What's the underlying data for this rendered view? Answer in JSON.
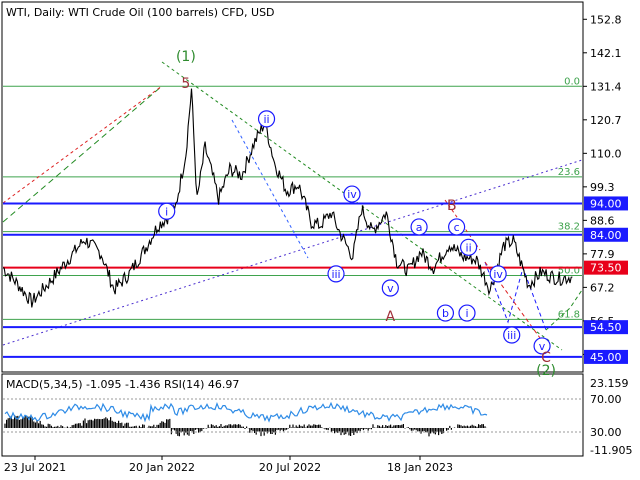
{
  "chart_data": [
    {
      "type": "line",
      "title": "WTI, Daily:  WTI Crude Oil (100 barrels) CFD, USD",
      "price_axis": {
        "ticks": [
          152.8,
          142.1,
          131.4,
          120.7,
          110.0,
          99.3,
          88.6,
          77.9,
          67.2,
          56.5,
          45.8
        ],
        "ylim": [
          40.5,
          158.0
        ]
      },
      "x_axis": {
        "ticks": [
          "23 Jul 2021",
          "20 Jan 2022",
          "20 Jul 2022",
          "18 Jan 2023"
        ],
        "xlim": [
          "2021-07-15",
          "2023-07-10"
        ]
      },
      "series": [
        {
          "color": "#000000",
          "x": [
            "2021-07-15",
            "2021-08-05",
            "2021-08-20",
            "2021-09-10",
            "2021-10-01",
            "2021-10-25",
            "2021-11-15",
            "2021-12-01",
            "2021-12-20",
            "2022-01-10",
            "2022-01-25",
            "2022-02-15",
            "2022-03-01",
            "2022-03-08",
            "2022-03-15",
            "2022-03-25",
            "2022-04-11",
            "2022-04-25",
            "2022-05-10",
            "2022-05-25",
            "2022-06-08",
            "2022-06-20",
            "2022-07-05",
            "2022-07-20",
            "2022-08-05",
            "2022-08-16",
            "2022-08-30",
            "2022-09-10",
            "2022-09-26",
            "2022-10-07",
            "2022-10-20",
            "2022-11-07",
            "2022-11-20",
            "2022-12-05",
            "2022-12-20",
            "2023-01-05",
            "2023-01-25",
            "2023-02-10",
            "2023-02-28",
            "2023-03-17",
            "2023-04-03",
            "2023-04-15",
            "2023-05-04",
            "2023-05-20",
            "2023-06-10",
            "2023-06-28"
          ],
          "y": [
            73.5,
            67.5,
            62.5,
            68.5,
            75.0,
            82.5,
            78.0,
            66.5,
            71.5,
            80.0,
            87.0,
            91.5,
            110.0,
            130.5,
            95.0,
            112.0,
            95.5,
            105.0,
            103.0,
            113.0,
            120.0,
            107.0,
            98.0,
            100.0,
            88.0,
            87.0,
            91.0,
            84.5,
            77.0,
            92.5,
            85.0,
            91.0,
            75.5,
            72.5,
            78.5,
            73.5,
            81.0,
            77.0,
            76.0,
            66.5,
            80.5,
            82.0,
            68.0,
            72.0,
            70.0,
            70.5
          ]
        }
      ],
      "levels": [
        {
          "value": 94.0,
          "label": "94.00",
          "color": "#1a1aff"
        },
        {
          "value": 84.0,
          "label": "84.00",
          "color": "#1a1aff"
        },
        {
          "value": 73.5,
          "label": "73.50",
          "color": "#e8001a"
        },
        {
          "value": 54.5,
          "label": "54.50",
          "color": "#1a1aff"
        },
        {
          "value": 45.0,
          "label": "45.00",
          "color": "#1a1aff"
        }
      ],
      "fibo_levels": [
        {
          "value": 131.4,
          "label": "0.0"
        },
        {
          "value": 102.5,
          "label": "23.6"
        },
        {
          "value": 85.0,
          "label": "38.2"
        },
        {
          "value": 71.0,
          "label": "50.0"
        },
        {
          "value": 57.0,
          "label": "61.8"
        }
      ],
      "annotations": [
        {
          "text": "(1)",
          "x": "2022-03-01",
          "y": 141.0,
          "color": "#2e8b2e"
        },
        {
          "text": "5",
          "x": "2022-03-01",
          "y": 132.5,
          "color": "#a0303a"
        },
        {
          "text": "ii",
          "x": "2022-06-10",
          "y": 121.0,
          "color": "#1a1aff",
          "circled": true
        },
        {
          "text": "i",
          "x": "2022-02-05",
          "y": 91.5,
          "color": "#1a1aff",
          "circled": true
        },
        {
          "text": "iv",
          "x": "2022-09-25",
          "y": 97.0,
          "color": "#1a1aff",
          "circled": true
        },
        {
          "text": "iii",
          "x": "2022-09-05",
          "y": 71.5,
          "color": "#1a1aff",
          "circled": true
        },
        {
          "text": "v",
          "x": "2022-11-12",
          "y": 67.0,
          "color": "#1a1aff",
          "circled": true
        },
        {
          "text": "A",
          "x": "2022-11-12",
          "y": 58.0,
          "color": "#a0303a"
        },
        {
          "text": "a",
          "x": "2022-12-18",
          "y": 86.5,
          "color": "#1a1aff",
          "circled": true
        },
        {
          "text": "B",
          "x": "2023-01-28",
          "y": 93.5,
          "color": "#a0303a"
        },
        {
          "text": "c",
          "x": "2023-02-03",
          "y": 86.5,
          "color": "#1a1aff",
          "circled": true
        },
        {
          "text": "ii",
          "x": "2023-02-18",
          "y": 80.0,
          "color": "#1a1aff",
          "circled": true
        },
        {
          "text": "b",
          "x": "2023-01-20",
          "y": 59.0,
          "color": "#1a1aff",
          "circled": true
        },
        {
          "text": "i",
          "x": "2023-02-16",
          "y": 59.0,
          "color": "#1a1aff",
          "circled": true
        },
        {
          "text": "iv",
          "x": "2023-03-27",
          "y": 71.5,
          "color": "#1a1aff",
          "circled": true
        },
        {
          "text": "iii",
          "x": "2023-04-13",
          "y": 52.0,
          "color": "#1a1aff",
          "circled": true
        },
        {
          "text": "v",
          "x": "2023-05-21",
          "y": 48.5,
          "color": "#1a1aff",
          "circled": true
        },
        {
          "text": "C",
          "x": "2023-05-26",
          "y": 45.0,
          "color": "#a0303a"
        },
        {
          "text": "(2)",
          "x": "2023-05-26",
          "y": 40.8,
          "color": "#2e8b2e"
        }
      ]
    },
    {
      "type": "line",
      "title": "MACD(5,34,5) -1.095 -1.436 RSI(14) 46.97",
      "indicator_axis": {
        "ticks": [
          23.159,
          70.0,
          30.0,
          -11.905
        ]
      },
      "series": [
        {
          "name": "RSI(14)",
          "color": "#2e8be6"
        },
        {
          "name": "MACD(5,34,5)",
          "color": "#000000"
        }
      ]
    }
  ]
}
